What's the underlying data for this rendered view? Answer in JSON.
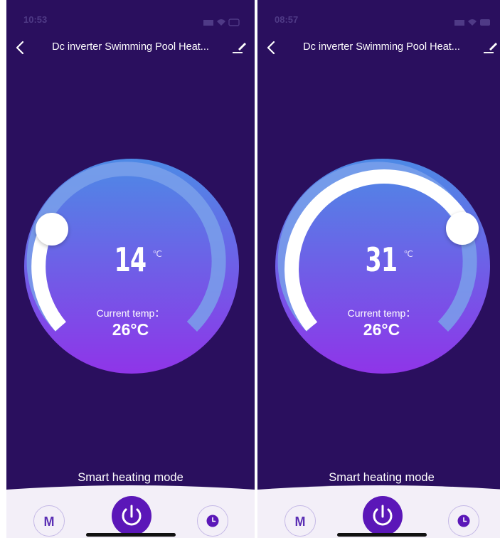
{
  "colors": {
    "background": "#2a0f5e",
    "dial_top": "#4d8ae6",
    "dial_bottom": "#8f35e8",
    "track": "#7aa0ea",
    "active_arc": "#ffffff",
    "accent": "#5b17b8",
    "bottom_bar": "#f3eff8"
  },
  "screens": [
    {
      "status": {
        "time": "10:53",
        "icons": [
          "location-arrow-icon",
          "signal-icon",
          "wifi-icon",
          "battery-icon"
        ]
      },
      "nav": {
        "title": "Dc inverter Swimming Pool Heat...",
        "back_icon": "chevron-left-icon",
        "edit_icon": "pencil-icon"
      },
      "target_temp": {
        "value": "14",
        "unit": "℃"
      },
      "current_temp": {
        "label": "Current temp：",
        "value": "26°C"
      },
      "mode_label": "Smart heating mode",
      "buttons": {
        "mode": "M",
        "power_icon": "power-icon",
        "timer_icon": "clock-icon"
      }
    },
    {
      "status": {
        "time": "08:57",
        "icons": [
          "location-arrow-icon",
          "signal-icon",
          "wifi-icon",
          "battery-icon"
        ]
      },
      "nav": {
        "title": "Dc inverter Swimming Pool Heat...",
        "back_icon": "chevron-left-icon",
        "edit_icon": "pencil-icon"
      },
      "target_temp": {
        "value": "31",
        "unit": "℃"
      },
      "current_temp": {
        "label": "Current temp：",
        "value": "26°C"
      },
      "mode_label": "Smart heating mode",
      "buttons": {
        "mode": "M",
        "power_icon": "power-icon",
        "timer_icon": "clock-icon"
      }
    }
  ]
}
